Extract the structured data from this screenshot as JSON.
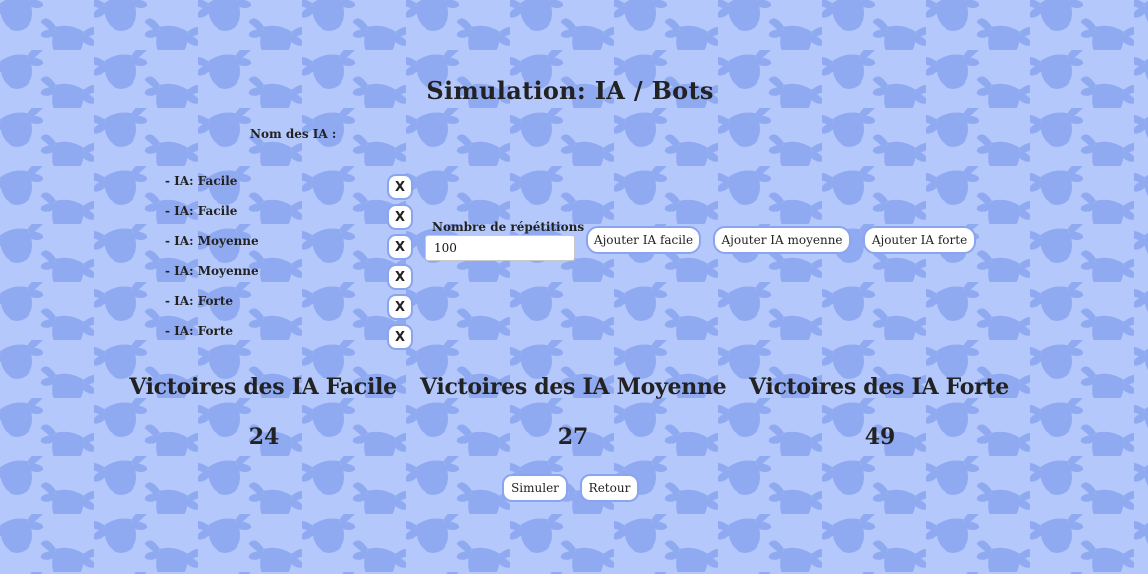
{
  "page": {
    "title": "Simulation: IA / Bots",
    "background_color": "#b4c8fc",
    "pattern_color": "#8aa4f0",
    "pattern_icon": "cow-head-icon"
  },
  "ia_list": {
    "label": "Nom des IA :",
    "items": [
      {
        "label": "- IA: Facile",
        "remove_label": "X"
      },
      {
        "label": "- IA: Facile",
        "remove_label": "X"
      },
      {
        "label": "- IA: Moyenne",
        "remove_label": "X"
      },
      {
        "label": "- IA: Moyenne",
        "remove_label": "X"
      },
      {
        "label": "- IA: Forte",
        "remove_label": "X"
      },
      {
        "label": "- IA: Forte",
        "remove_label": "X"
      }
    ]
  },
  "repetitions": {
    "label": "Nombre de répétitions",
    "value": "100"
  },
  "add_buttons": {
    "easy": "Ajouter IA facile",
    "medium": "Ajouter IA moyenne",
    "hard": "Ajouter IA forte"
  },
  "stats": [
    {
      "label": "Victoires des IA Facile",
      "value": "24"
    },
    {
      "label": "Victoires des IA Moyenne",
      "value": "27"
    },
    {
      "label": "Victoires des IA Forte",
      "value": "49"
    }
  ],
  "actions": {
    "simulate": "Simuler",
    "back": "Retour"
  },
  "accent_color": "#8aa4f0"
}
